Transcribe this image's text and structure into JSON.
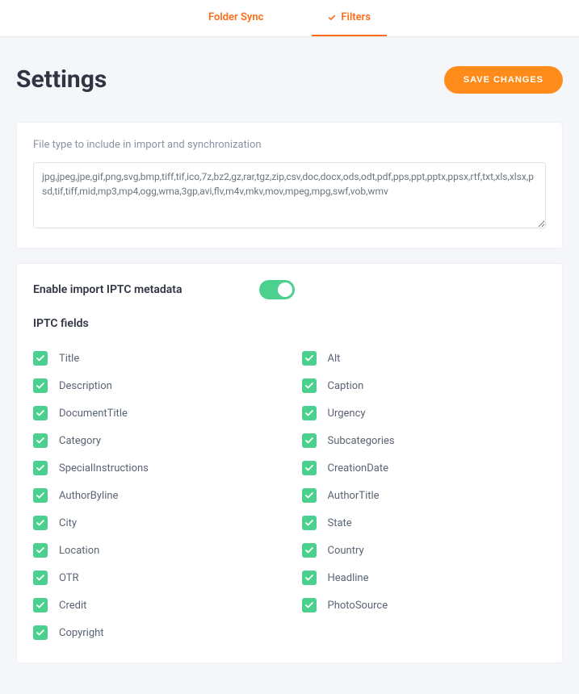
{
  "tabs": {
    "folder_sync": "Folder Sync",
    "filters": "Filters"
  },
  "page": {
    "title": "Settings"
  },
  "buttons": {
    "save": "SAVE CHANGES"
  },
  "filetype_section": {
    "label": "File type to include in import and synchronization",
    "value": "jpg,jpeg,jpe,gif,png,svg,bmp,tiff,tif,ico,7z,bz2,gz,rar,tgz,zip,csv,doc,docx,ods,odt,pdf,pps,ppt,pptx,ppsx,rtf,txt,xls,xlsx,psd,tif,tiff,mid,mp3,mp4,ogg,wma,3gp,avi,flv,m4v,mkv,mov,mpeg,mpg,swf,vob,wmv"
  },
  "iptc_section": {
    "toggle_label": "Enable import IPTC metadata",
    "fields_label": "IPTC fields"
  },
  "iptc_fields": {
    "left": [
      "Title",
      "Description",
      "DocumentTitle",
      "Category",
      "SpecialInstructions",
      "AuthorByline",
      "City",
      "Location",
      "OTR",
      "Credit",
      "Copyright"
    ],
    "right": [
      "Alt",
      "Caption",
      "Urgency",
      "Subcategories",
      "CreationDate",
      "AuthorTitle",
      "State",
      "Country",
      "Headline",
      "PhotoSource"
    ]
  }
}
